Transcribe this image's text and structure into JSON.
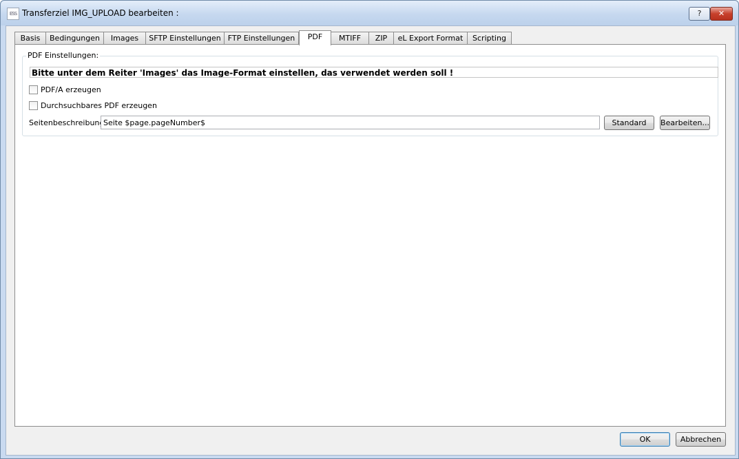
{
  "window": {
    "title": "Transferziel IMG_UPLOAD bearbeiten :",
    "app_icon_text": "ESS",
    "help_label": "?",
    "close_label": "✕"
  },
  "tabs": [
    {
      "label": "Basis"
    },
    {
      "label": "Bedingungen"
    },
    {
      "label": "Images"
    },
    {
      "label": "SFTP Einstellungen"
    },
    {
      "label": "FTP Einstellungen"
    },
    {
      "label": "PDF"
    },
    {
      "label": "MTIFF"
    },
    {
      "label": "ZIP"
    },
    {
      "label": "eL Export Format"
    },
    {
      "label": "Scripting"
    }
  ],
  "active_tab": "PDF",
  "pdf_settings": {
    "group_title": "PDF Einstellungen:",
    "notice": "Bitte unter dem Reiter 'Images' das Image-Format einstellen, das verwendet werden soll !",
    "pdfa_label": "PDF/A erzeugen",
    "pdfa_checked": false,
    "searchable_label": "Durchsuchbares PDF erzeugen",
    "searchable_checked": false,
    "page_desc_label": "Seitenbeschreibung:",
    "page_desc_value": "Seite $page.pageNumber$",
    "standard_button": "Standard",
    "edit_button": "Bearbeiten..."
  },
  "footer": {
    "ok_label": "OK",
    "cancel_label": "Abbrechen"
  }
}
